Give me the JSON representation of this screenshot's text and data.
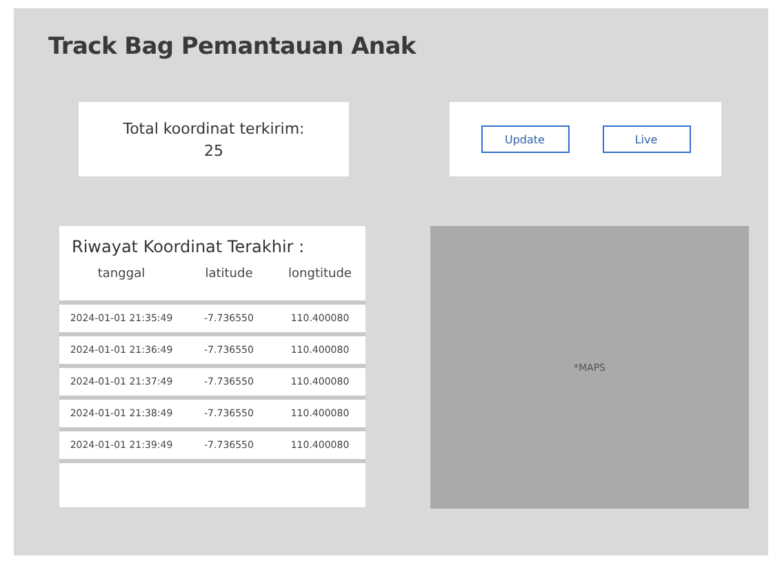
{
  "title": "Track Bag Pemantauan Anak",
  "total": {
    "label": "Total koordinat terkirim:",
    "value": "25"
  },
  "buttons": [
    "Update",
    "Live"
  ],
  "history": {
    "title": "Riwayat Koordinat Terakhir :",
    "columns": [
      "tanggal",
      "latitude",
      "longtitude"
    ],
    "rows": [
      [
        "2024-01-01 21:35:49",
        "-7.736550",
        "110.400080"
      ],
      [
        "2024-01-01 21:36:49",
        "-7.736550",
        "110.400080"
      ],
      [
        "2024-01-01 21:37:49",
        "-7.736550",
        "110.400080"
      ],
      [
        "2024-01-01 21:38:49",
        "-7.736550",
        "110.400080"
      ],
      [
        "2024-01-01 21:39:49",
        "-7.736550",
        "110.400080"
      ]
    ]
  },
  "map": {
    "label": "*MAPS"
  }
}
